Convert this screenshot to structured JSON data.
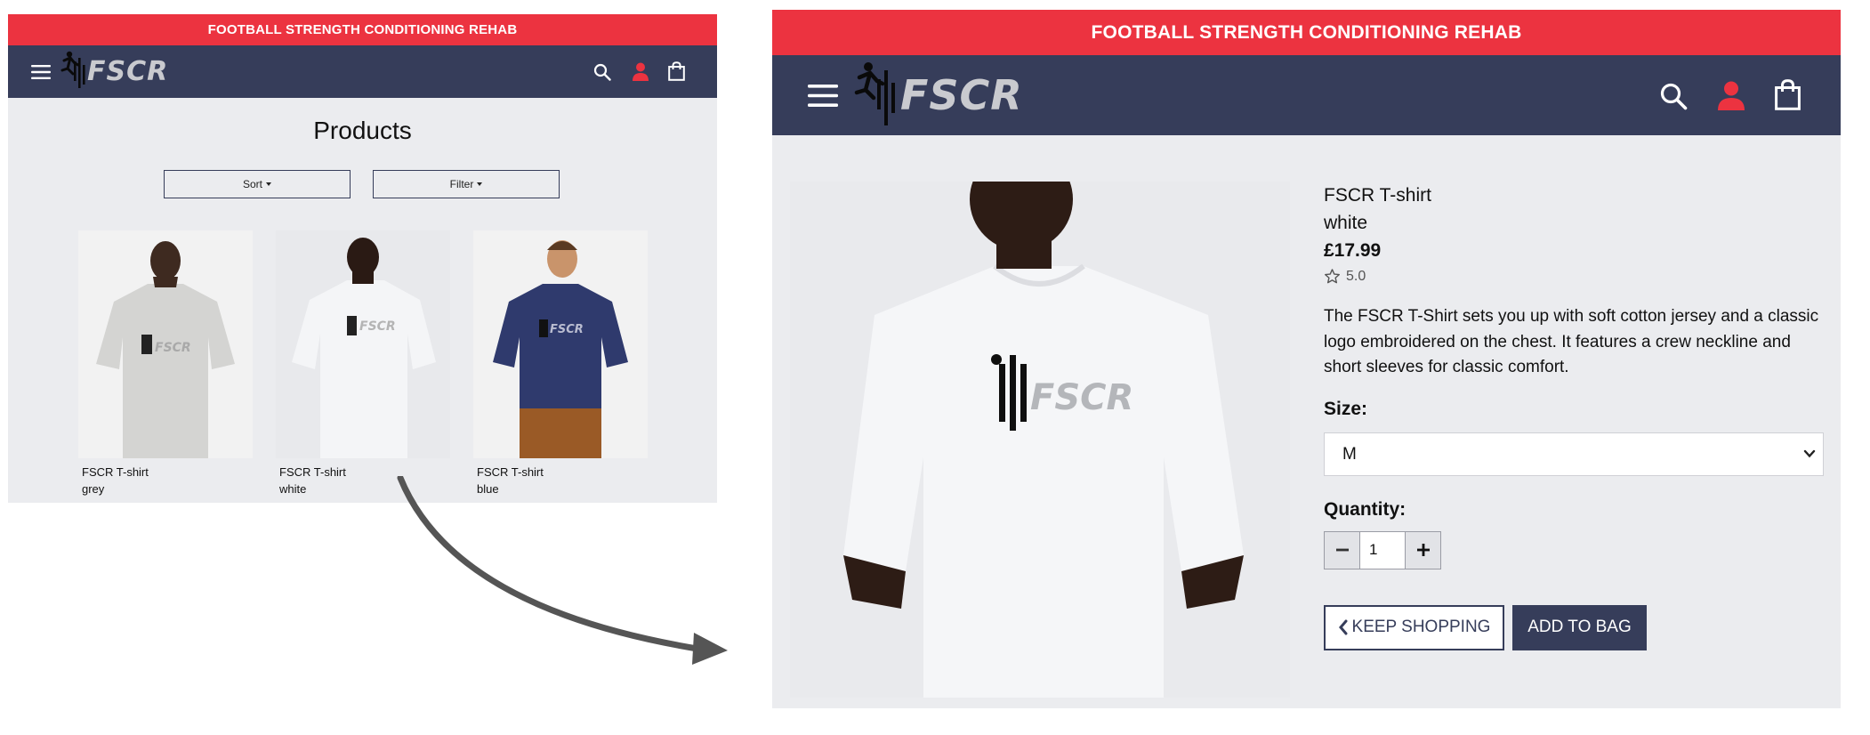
{
  "left": {
    "banner": "FOOTBALL STRENGTH CONDITIONING REHAB",
    "logo_text": "FSCR",
    "page_title": "Products",
    "sort_label": "Sort",
    "filter_label": "Filter",
    "products": [
      {
        "name": "FSCR T-shirt",
        "color": "grey"
      },
      {
        "name": "FSCR T-shirt",
        "color": "white"
      },
      {
        "name": "FSCR T-shirt",
        "color": "blue"
      }
    ]
  },
  "right": {
    "banner": "FOOTBALL STRENGTH CONDITIONING REHAB",
    "logo_text": "FSCR",
    "product": {
      "name": "FSCR T-shirt",
      "color": "white",
      "price": "£17.99",
      "rating": "5.0",
      "description": "The FSCR T-Shirt sets you up with soft cotton jersey and a classic logo embroidered on the chest. It features a crew neckline and short sleeves for classic comfort."
    },
    "size_label": "Size:",
    "size_value": "M",
    "quantity_label": "Quantity:",
    "quantity_value": "1",
    "keep_shopping_label": "KEEP SHOPPING",
    "add_to_bag_label": "ADD TO BAG"
  },
  "icons": [
    "menu-icon",
    "search-icon",
    "account-icon",
    "shopping-bag-icon",
    "star-icon",
    "minus-icon",
    "plus-icon",
    "chevron-left-icon",
    "chevron-down-icon"
  ],
  "colors": {
    "banner_red": "#ec3340",
    "navbar_navy": "#363d5a",
    "panel_bg": "#ebecef",
    "account_icon_red": "#ec3340",
    "shirt_grey": "#d4d4d2",
    "shirt_white": "#f4f5f7",
    "shirt_blue": "#2f3a6d"
  }
}
